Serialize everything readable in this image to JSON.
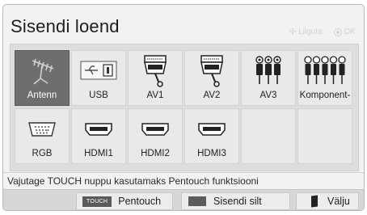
{
  "title": "Sisendi loend",
  "hint": {
    "move_label": "Liiguta",
    "ok_label": "OK"
  },
  "inputs_row1": [
    {
      "label": "Antenn",
      "icon": "antenna-icon",
      "selected": true
    },
    {
      "label": "USB",
      "icon": "usb-icon",
      "selected": false
    },
    {
      "label": "AV1",
      "icon": "scart-icon",
      "selected": false
    },
    {
      "label": "AV2",
      "icon": "scart-icon",
      "selected": false
    },
    {
      "label": "AV3",
      "icon": "rca-av-icon",
      "selected": false
    },
    {
      "label": "Komponent-",
      "icon": "rca-component-icon",
      "selected": false
    }
  ],
  "inputs_row2": [
    {
      "label": "RGB",
      "icon": "vga-icon",
      "selected": false
    },
    {
      "label": "HDMI1",
      "icon": "hdmi-icon",
      "selected": false
    },
    {
      "label": "HDMI2",
      "icon": "hdmi-icon",
      "selected": false
    },
    {
      "label": "HDMI3",
      "icon": "hdmi-icon",
      "selected": false
    },
    {
      "label": "",
      "icon": "",
      "selected": false
    },
    {
      "label": "",
      "icon": "",
      "selected": false
    }
  ],
  "status_text": "Vajutage TOUCH nuppu kasutamaks Pentouch funktsiooni",
  "bottom_bar": {
    "touch_chip": "TOUCH",
    "pentouch_label": "Pentouch",
    "input_label_button": "Sisendi silt",
    "exit_label": "Välju"
  },
  "colors": {
    "selected_tile": "#6e6e6e",
    "tile": "#e9e9e9",
    "bar": "#d7d7d7"
  }
}
